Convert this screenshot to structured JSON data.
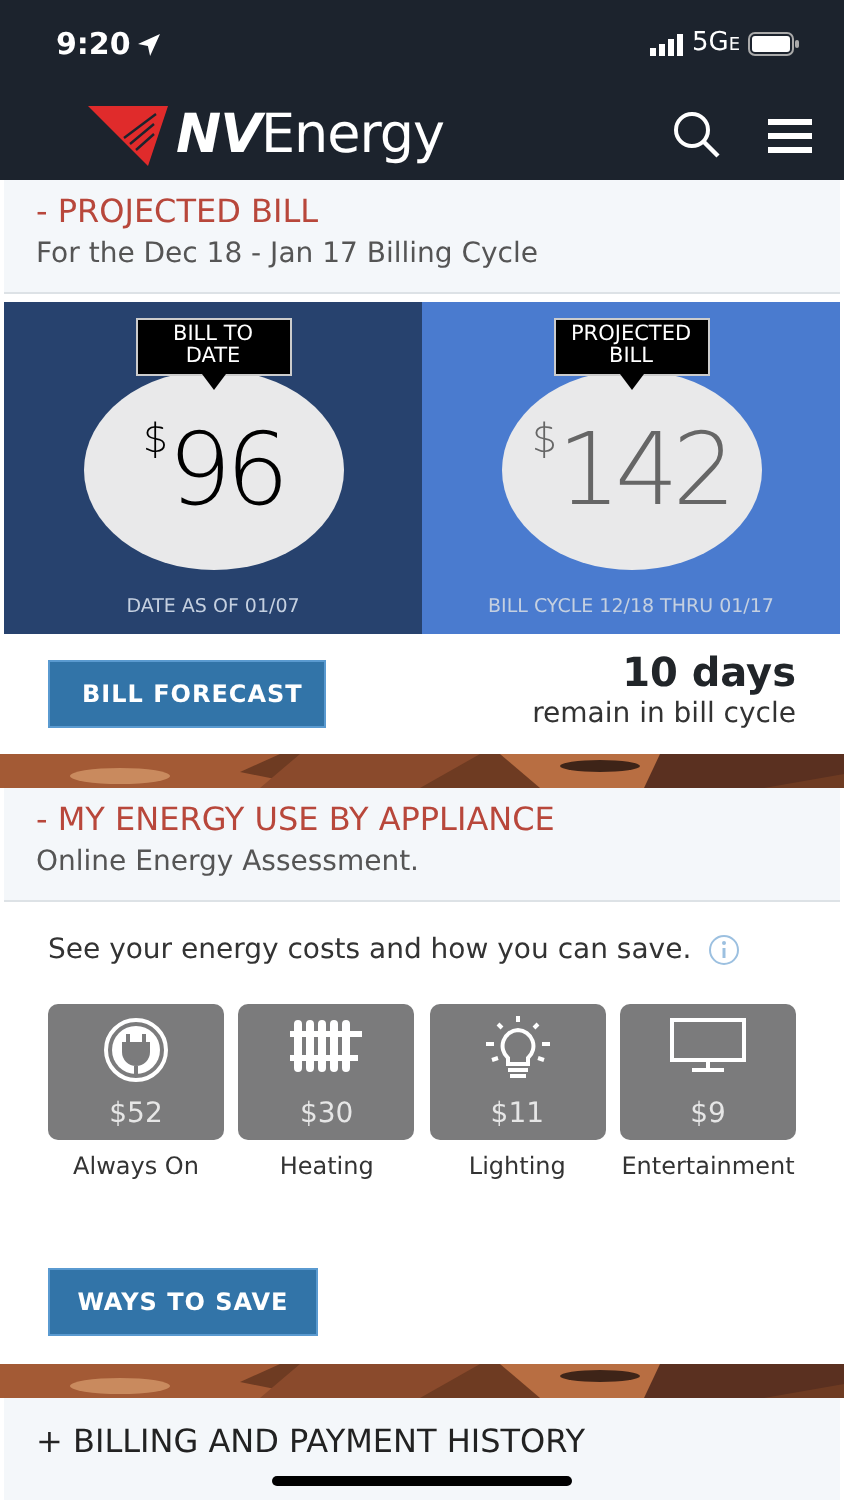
{
  "status_bar": {
    "time": "9:20",
    "network": "5G",
    "network_suffix": "E"
  },
  "header": {
    "brand_bold": "NV",
    "brand_light": "Energy"
  },
  "projected_bill": {
    "title": "- PROJECTED BILL",
    "subtitle": "For the Dec 18 - Jan 17 Billing Cycle",
    "panels": [
      {
        "label": "BILL TO DATE",
        "symbol": "$",
        "amount": "96",
        "note": "DATE AS OF 01/07",
        "kind": "actual"
      },
      {
        "label": "PROJECTED BILL",
        "symbol": "$",
        "amount": "142",
        "note": "BILL CYCLE 12/18 THRU 01/17",
        "kind": "projected"
      }
    ],
    "button": "BILL FORECAST",
    "days": "10 days",
    "days_note": "remain in bill cycle"
  },
  "appliance": {
    "title": "- MY ENERGY USE BY APPLIANCE",
    "subtitle": "Online Energy Assessment.",
    "intro": "See your energy costs and how you can save.",
    "tiles": [
      {
        "kind": "plug",
        "cost": "$52",
        "label": "Always On"
      },
      {
        "kind": "radiator",
        "cost": "$30",
        "label": "Heating"
      },
      {
        "kind": "bulb",
        "cost": "$11",
        "label": "Lighting"
      },
      {
        "kind": "tv",
        "cost": "$9",
        "label": "Entertainment"
      }
    ],
    "button": "WAYS TO SAVE"
  },
  "billing_history": {
    "title": "+ BILLING AND PAYMENT HISTORY"
  }
}
